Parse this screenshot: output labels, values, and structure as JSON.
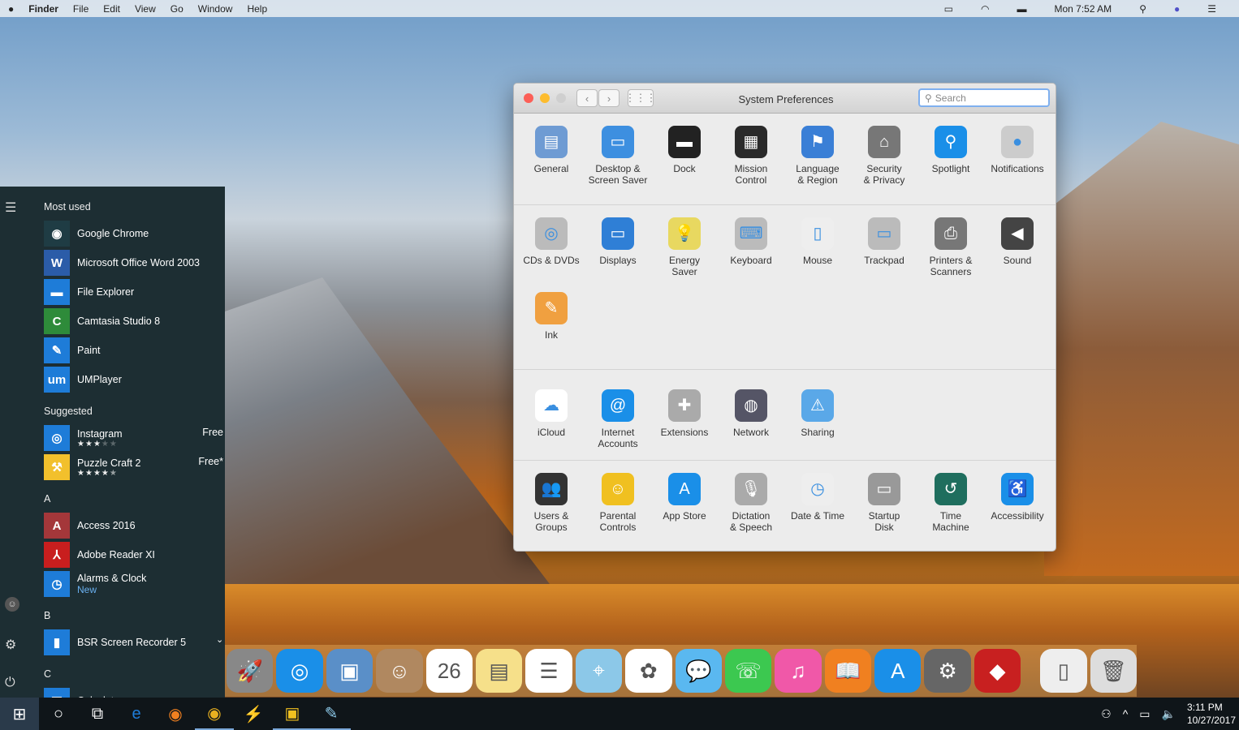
{
  "menubar": {
    "items": [
      "Finder",
      "File",
      "Edit",
      "View",
      "Go",
      "Window",
      "Help"
    ],
    "clock": "Mon 7:52 AM"
  },
  "start": {
    "most_used_label": "Most used",
    "most_used": [
      {
        "name": "Google Chrome",
        "color": "#1f3c44",
        "glyph": "◉"
      },
      {
        "name": "Microsoft Office Word 2003",
        "color": "#2b5ca8",
        "glyph": "W"
      },
      {
        "name": "File Explorer",
        "color": "#1e7cd8",
        "glyph": "▬"
      },
      {
        "name": "Camtasia Studio 8",
        "color": "#2e8b3a",
        "glyph": "C"
      },
      {
        "name": "Paint",
        "color": "#1e7cd8",
        "glyph": "✎"
      },
      {
        "name": "UMPlayer",
        "color": "#1e7cd8",
        "glyph": "um"
      }
    ],
    "suggested_label": "Suggested",
    "suggested": [
      {
        "name": "Instagram",
        "price": "Free",
        "stars": "★★★★★",
        "rating": 3,
        "color": "#1e7cd8",
        "glyph": "◎"
      },
      {
        "name": "Puzzle Craft 2",
        "price": "Free*",
        "stars": "★★★★★",
        "rating": 4.5,
        "color": "#f2c02c",
        "glyph": "⚒"
      }
    ],
    "groups": [
      {
        "letter": "A",
        "apps": [
          {
            "name": "Access 2016",
            "color": "#a4373a",
            "glyph": "A"
          },
          {
            "name": "Adobe Reader XI",
            "color": "#c81e1e",
            "glyph": "⅄"
          },
          {
            "name": "Alarms & Clock",
            "sub": "New",
            "color": "#1e7cd8",
            "glyph": "◷"
          }
        ]
      },
      {
        "letter": "B",
        "apps": [
          {
            "name": "BSR Screen Recorder 5",
            "color": "#1e7cd8",
            "glyph": "▮"
          }
        ]
      },
      {
        "letter": "C",
        "apps": [
          {
            "name": "Calculator",
            "color": "#1e7cd8",
            "glyph": "▦"
          }
        ]
      }
    ]
  },
  "taskbar": {
    "time": "3:11 PM",
    "date": "10/27/2017"
  },
  "prefs": {
    "title": "System Preferences",
    "search_placeholder": "Search",
    "sections": [
      [
        {
          "l1": "General",
          "l2": "",
          "c": "#6e9bd3",
          "g": "▤"
        },
        {
          "l1": "Desktop &",
          "l2": "Screen Saver",
          "c": "#3d8fe0",
          "g": "▭"
        },
        {
          "l1": "Dock",
          "l2": "",
          "c": "#222",
          "g": "▬"
        },
        {
          "l1": "Mission",
          "l2": "Control",
          "c": "#2a2a2a",
          "g": "▦"
        },
        {
          "l1": "Language",
          "l2": "& Region",
          "c": "#3a7fd6",
          "g": "⚑"
        },
        {
          "l1": "Security",
          "l2": "& Privacy",
          "c": "#777",
          "g": "⌂"
        },
        {
          "l1": "Spotlight",
          "l2": "",
          "c": "#1a8fe8",
          "g": "⚲"
        },
        {
          "l1": "Notifications",
          "l2": "",
          "c": "#ccc",
          "g": "●"
        }
      ],
      [
        {
          "l1": "CDs & DVDs",
          "l2": "",
          "c": "#bbb",
          "g": "◎"
        },
        {
          "l1": "Displays",
          "l2": "",
          "c": "#2f7fd6",
          "g": "▭"
        },
        {
          "l1": "Energy",
          "l2": "Saver",
          "c": "#e8d860",
          "g": "💡"
        },
        {
          "l1": "Keyboard",
          "l2": "",
          "c": "#bbb",
          "g": "⌨"
        },
        {
          "l1": "Mouse",
          "l2": "",
          "c": "#eee",
          "g": "▯"
        },
        {
          "l1": "Trackpad",
          "l2": "",
          "c": "#bbb",
          "g": "▭"
        },
        {
          "l1": "Printers &",
          "l2": "Scanners",
          "c": "#777",
          "g": "⎙"
        },
        {
          "l1": "Sound",
          "l2": "",
          "c": "#444",
          "g": "◀"
        },
        {
          "l1": "Ink",
          "l2": "",
          "c": "#f0a040",
          "g": "✎"
        }
      ],
      [
        {
          "l1": "iCloud",
          "l2": "",
          "c": "#fff",
          "g": "☁"
        },
        {
          "l1": "Internet",
          "l2": "Accounts",
          "c": "#1a8fe8",
          "g": "@"
        },
        {
          "l1": "Extensions",
          "l2": "",
          "c": "#aaa",
          "g": "✚"
        },
        {
          "l1": "Network",
          "l2": "",
          "c": "#556",
          "g": "◍"
        },
        {
          "l1": "Sharing",
          "l2": "",
          "c": "#5aa8e8",
          "g": "⚠"
        }
      ],
      [
        {
          "l1": "Users &",
          "l2": "Groups",
          "c": "#333",
          "g": "👥"
        },
        {
          "l1": "Parental",
          "l2": "Controls",
          "c": "#f0c020",
          "g": "☺"
        },
        {
          "l1": "App Store",
          "l2": "",
          "c": "#1a8fe8",
          "g": "A"
        },
        {
          "l1": "Dictation",
          "l2": "& Speech",
          "c": "#aaa",
          "g": "🎙"
        },
        {
          "l1": "Date & Time",
          "l2": "",
          "c": "#eee",
          "g": "◷"
        },
        {
          "l1": "Startup",
          "l2": "Disk",
          "c": "#999",
          "g": "▭"
        },
        {
          "l1": "Time",
          "l2": "Machine",
          "c": "#1f6e5e",
          "g": "↺"
        },
        {
          "l1": "Accessibility",
          "l2": "",
          "c": "#1a8fe8",
          "g": "♿"
        }
      ]
    ]
  },
  "dock": [
    {
      "n": "launchpad",
      "c": "#888",
      "g": "🚀"
    },
    {
      "n": "safari",
      "c": "#1a8fe8",
      "g": "◎"
    },
    {
      "n": "preview",
      "c": "#5a8fc8",
      "g": "▣"
    },
    {
      "n": "contacts",
      "c": "#b08860",
      "g": "☺"
    },
    {
      "n": "calendar",
      "c": "#fff",
      "g": "26"
    },
    {
      "n": "notes",
      "c": "#f6e08a",
      "g": "▤"
    },
    {
      "n": "reminders",
      "c": "#fff",
      "g": "☰"
    },
    {
      "n": "maps",
      "c": "#8cc8e8",
      "g": "⌖"
    },
    {
      "n": "photos",
      "c": "#fff",
      "g": "✿"
    },
    {
      "n": "messages",
      "c": "#5ab8f0",
      "g": "💬"
    },
    {
      "n": "facetime",
      "c": "#3cc850",
      "g": "☏"
    },
    {
      "n": "itunes",
      "c": "#f058a8",
      "g": "♫"
    },
    {
      "n": "ibooks",
      "c": "#f08020",
      "g": "📖"
    },
    {
      "n": "app-store",
      "c": "#1a8fe8",
      "g": "A"
    },
    {
      "n": "system-preferences",
      "c": "#666",
      "g": "⚙"
    },
    {
      "n": "lipstick",
      "c": "#c82020",
      "g": "◆"
    },
    {
      "n": "downloads",
      "c": "#eee",
      "g": "▯"
    },
    {
      "n": "trash",
      "c": "#ddd",
      "g": "🗑"
    }
  ]
}
